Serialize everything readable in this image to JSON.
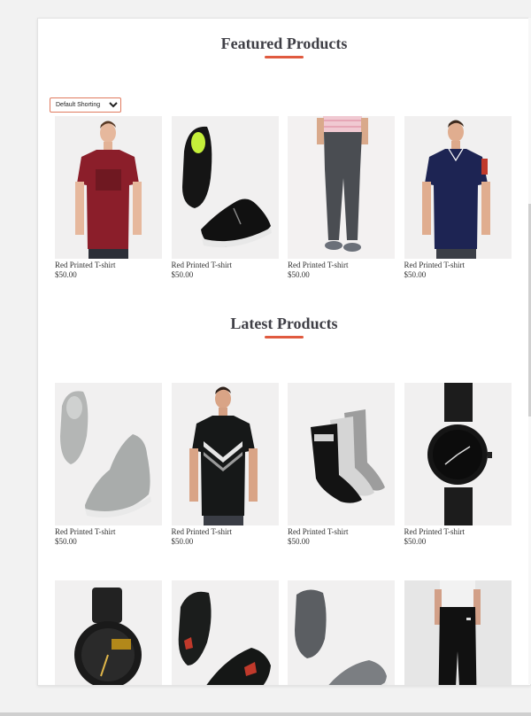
{
  "featured": {
    "title": "Featured Products",
    "sort_selected": "Default Shorting",
    "products": [
      {
        "name": "Red Printed T-shirt",
        "price": "$50.00",
        "image": "red-tshirt-model"
      },
      {
        "name": "Red Printed T-shirt",
        "price": "$50.00",
        "image": "black-sneakers"
      },
      {
        "name": "Red Printed T-shirt",
        "price": "$50.00",
        "image": "grey-joggers"
      },
      {
        "name": "Red Printed T-shirt",
        "price": "$50.00",
        "image": "navy-polo-shirt"
      }
    ]
  },
  "latest": {
    "title": "Latest Products",
    "products": [
      {
        "name": "Red Printed T-shirt",
        "price": "$50.00",
        "image": "grey-high-top-shoes"
      },
      {
        "name": "Red Printed T-shirt",
        "price": "$50.00",
        "image": "black-puma-tshirt"
      },
      {
        "name": "Red Printed T-shirt",
        "price": "$50.00",
        "image": "hrx-socks"
      },
      {
        "name": "Red Printed T-shirt",
        "price": "$50.00",
        "image": "black-wrist-watch"
      }
    ],
    "products_row2": [
      {
        "image": "sport-watch"
      },
      {
        "image": "black-red-sneakers"
      },
      {
        "image": "grey-slip-on-shoes"
      },
      {
        "image": "black-track-pants"
      }
    ]
  },
  "colors": {
    "accent": "#e05a3f",
    "title": "#3f3f46",
    "thumb_bg": "#efeeee"
  }
}
